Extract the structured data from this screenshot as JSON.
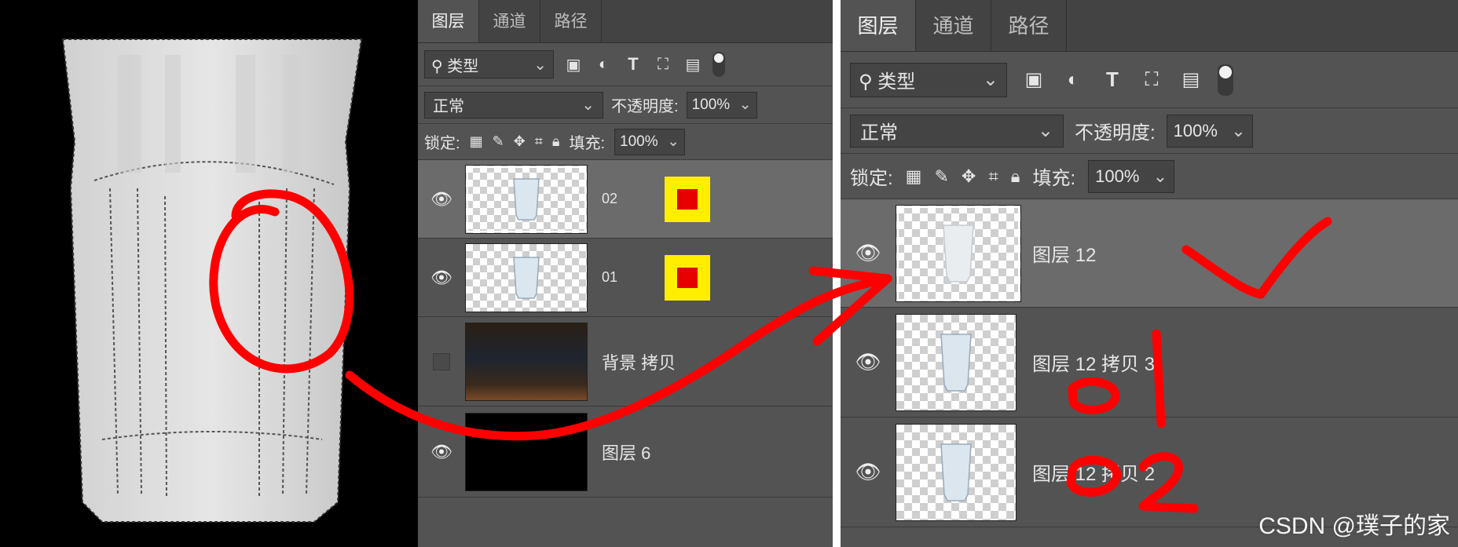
{
  "panel_left": {
    "tabs": [
      "图层",
      "通道",
      "路径"
    ],
    "filter_label": "类型",
    "blend_mode": "正常",
    "opacity_label": "不透明度:",
    "opacity_value": "100%",
    "lock_label": "锁定:",
    "fill_label": "填充:",
    "fill_value": "100%",
    "layers": [
      {
        "name": "02",
        "visible": true
      },
      {
        "name": "01",
        "visible": true
      },
      {
        "name": "背景 拷贝",
        "visible": false
      },
      {
        "name": "图层 6",
        "visible": true
      }
    ]
  },
  "panel_right": {
    "tabs": [
      "图层",
      "通道",
      "路径"
    ],
    "filter_label": "类型",
    "blend_mode": "正常",
    "opacity_label": "不透明度:",
    "opacity_value": "100%",
    "lock_label": "锁定:",
    "fill_label": "填充:",
    "fill_value": "100%",
    "layers": [
      {
        "name": "图层 12",
        "visible": true
      },
      {
        "name": "图层 12 拷贝 3",
        "visible": true
      },
      {
        "name": "图层 12 拷贝 2",
        "visible": true
      }
    ]
  },
  "annotations": {
    "checkmark": "✓",
    "label_01": "01",
    "label_02": "02"
  },
  "watermark": "CSDN @璞子的家",
  "colors": {
    "annotation": "#ff0000",
    "panel_bg": "#535353",
    "marker_yellow": "#ffee00",
    "marker_red": "#e60000"
  }
}
